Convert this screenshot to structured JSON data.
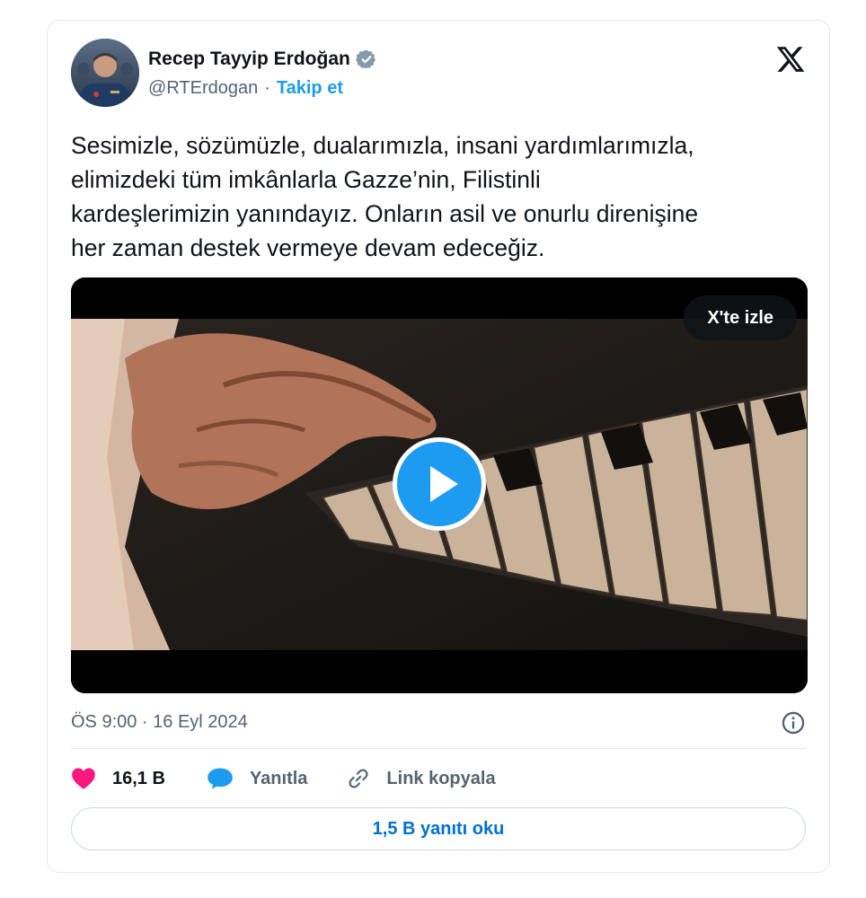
{
  "author": {
    "name": "Recep Tayyip Erdoğan",
    "handle": "@RTErdogan",
    "separator": "·",
    "follow_label": "Takip et",
    "verified": true
  },
  "tweet": {
    "text": "Sesimizle, sözümüzle, dualarımızla, insani yardımlarımızla,\nelimizdeki tüm imkânlarla Gazze’nin, Filistinli\nkardeşlerimizin yanındayız. Onların asil ve onurlu direnişine\nher zaman destek vermeye devam edeceğiz.",
    "timestamp": "ÖS 9:00 · 16 Eyl 2024"
  },
  "media": {
    "watch_label": "X'te izle",
    "play_icon": "play-icon"
  },
  "actions": {
    "like_count": "16,1 B",
    "reply_label": "Yanıtla",
    "copy_link_label": "Link kopyala",
    "read_replies_label": "1,5 B yanıtı oku"
  },
  "colors": {
    "accent": "#1d9bf0",
    "like": "#f91880",
    "link": "#006fd6",
    "muted": "#536471"
  },
  "icons": [
    "verified-badge-icon",
    "x-logo-icon",
    "info-icon",
    "heart-icon",
    "reply-bubble-icon",
    "link-icon"
  ]
}
